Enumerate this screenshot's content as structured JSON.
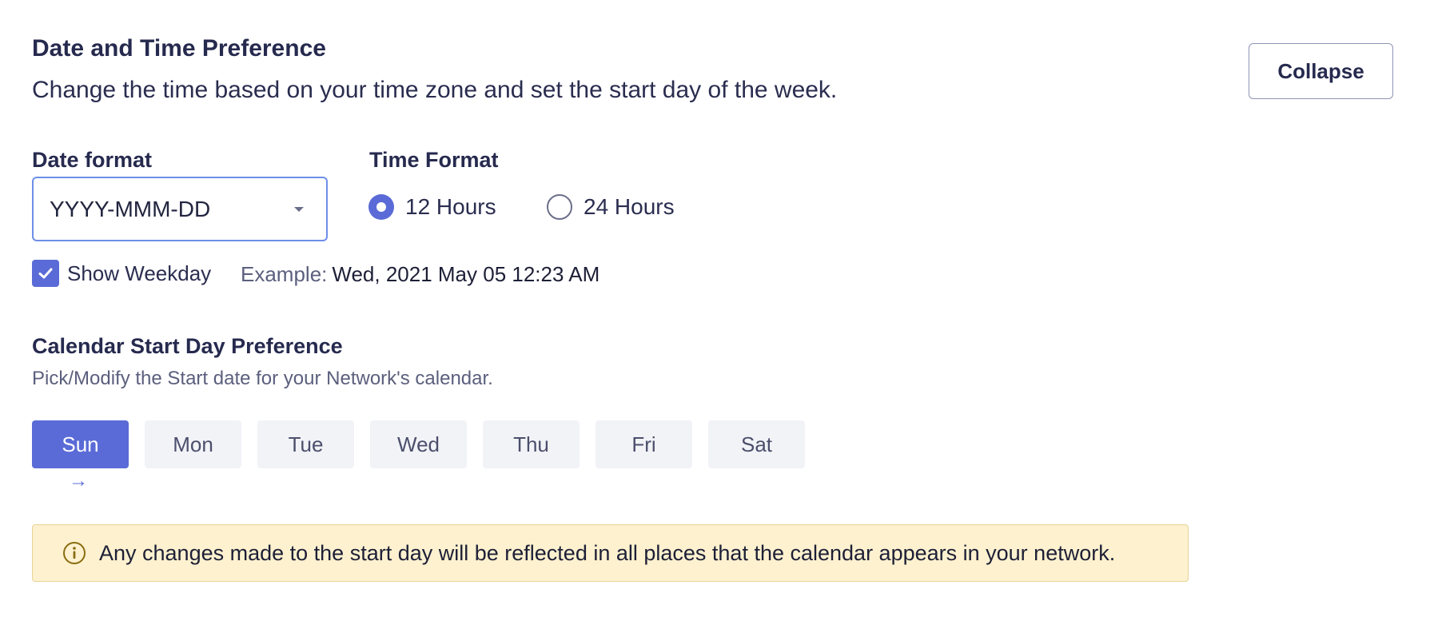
{
  "header": {
    "title": "Date and Time Preference",
    "subtitle": "Change the time based on your time zone and set the start day of the week.",
    "collapse_label": "Collapse"
  },
  "date_format": {
    "label": "Date format",
    "value": "YYYY-MMM-DD"
  },
  "time_format": {
    "label": "Time Format",
    "options": [
      {
        "label": "12 Hours",
        "selected": true
      },
      {
        "label": "24 Hours",
        "selected": false
      }
    ]
  },
  "show_weekday": {
    "label": "Show Weekday",
    "checked": true
  },
  "example": {
    "label": "Example:",
    "value": "Wed, 2021 May 05 12:23 AM"
  },
  "calendar": {
    "title": "Calendar Start Day Preference",
    "subtitle": "Pick/Modify the Start date for your Network's calendar.",
    "days": [
      "Sun",
      "Mon",
      "Tue",
      "Wed",
      "Thu",
      "Fri",
      "Sat"
    ],
    "selected_day": "Sun",
    "arrow": "→"
  },
  "notice": {
    "icon": "info-icon",
    "text": "Any changes made to the start day will be reflected in all places that the calendar appears in your network."
  },
  "colors": {
    "accent": "#5a6bd7",
    "notice_bg": "#fdf1cf",
    "day_bg": "#f2f3f7"
  }
}
